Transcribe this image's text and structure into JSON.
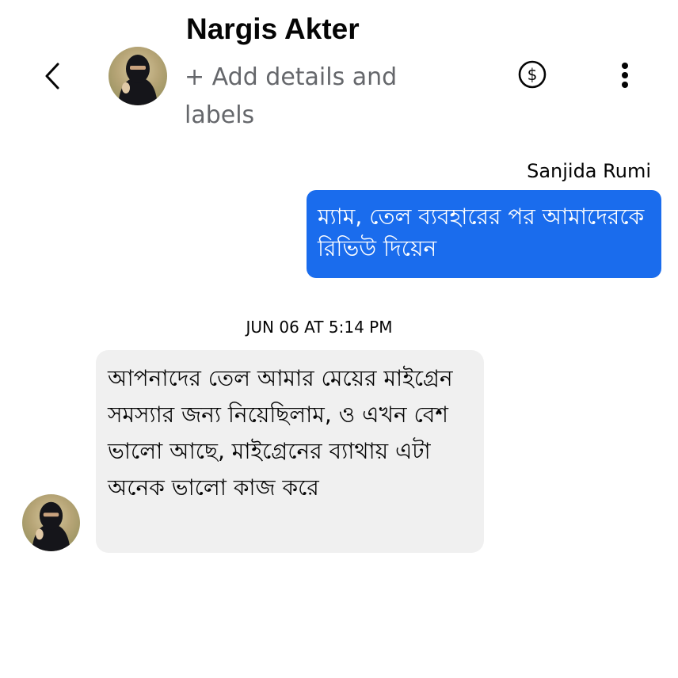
{
  "header": {
    "back_icon": "chevron-left-icon",
    "contact_name": "Nargis Akter",
    "add_details_label": "+ Add details and labels",
    "payment_icon": "dollar-circle-icon",
    "more_icon": "vertical-dots-icon"
  },
  "messages": {
    "outgoing_sender": "Sanjida Rumi",
    "outgoing_text": "ম্যাম, তেল ব্যবহারের পর আমাদেরকে রিভিউ দিয়েন",
    "timestamp": "JUN 06 AT 5:14 PM",
    "incoming_text": "আপনাদের তেল আমার মেয়ের মাইগ্রেন সমস্যার জন্য নিয়েছিলাম, ও এখন বেশ ভালো আছে, মাইগ্রেনের ব্যাথায় এটা অনেক ভালো কাজ করে"
  },
  "colors": {
    "outgoing_bubble": "#1a6ced",
    "incoming_bubble": "#f0f0f0",
    "secondary_text": "#65676b"
  }
}
